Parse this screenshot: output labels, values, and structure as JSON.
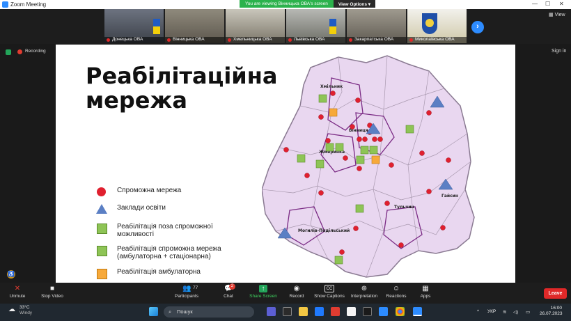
{
  "window": {
    "app_title": "Zoom Meeting"
  },
  "share_banner": {
    "viewing_text": "You are viewing Вінницька ОВА's screen",
    "view_options": "View Options"
  },
  "participants": [
    {
      "name": "Донецька ОВА"
    },
    {
      "name": "Вінницька ОВА"
    },
    {
      "name": "Хмельницька ОВА"
    },
    {
      "name": "Львівська ОВА"
    },
    {
      "name": "Закарпатська ОВА"
    },
    {
      "name": "Миколаївська ОВА"
    }
  ],
  "top": {
    "view_label": "View",
    "recording_label": "Recording",
    "signin_label": "Sign in"
  },
  "slide": {
    "title_line1": "Реабілітаційна",
    "title_line2": "мережа",
    "legend": [
      {
        "marker": "red-circle",
        "text": "Спроможна мережа"
      },
      {
        "marker": "blue-triangle",
        "text": "Заклади освіти"
      },
      {
        "marker": "green-square",
        "text": "Реабілітація поза спроможної можливості"
      },
      {
        "marker": "green-square",
        "text": "Реабілітація спроможна мережа (амбулаторна + стаціонарна)"
      },
      {
        "marker": "orange-square",
        "text": "Реабілітація амбулаторна"
      }
    ],
    "map_labels": [
      "Хмільник",
      "Вінниця",
      "Жмеринка",
      "Гайсин",
      "Тульчин",
      "Могилів-Подільський"
    ],
    "colors": {
      "region_fill": "#e9d7f0",
      "border": "#8a7a92",
      "circle": "#e0202f",
      "triangle": "#5b7fc4",
      "green": "#8ec456",
      "orange": "#f7a93a"
    }
  },
  "controls": {
    "unmute": "Unmute",
    "stop_video": "Stop Video",
    "participants": "Participants",
    "participants_count": "77",
    "chat": "Chat",
    "chat_badge": "2",
    "share_screen": "Share Screen",
    "record": "Record",
    "show_captions": "Show Captions",
    "interpretation": "Interpretation",
    "reactions": "Reactions",
    "apps": "Apps",
    "leave": "Leave"
  },
  "taskbar": {
    "temperature": "33°C",
    "weather": "Windy",
    "search_placeholder": "Пошук",
    "language": "УКР",
    "time": "16:00",
    "date": "26.07.2023"
  }
}
